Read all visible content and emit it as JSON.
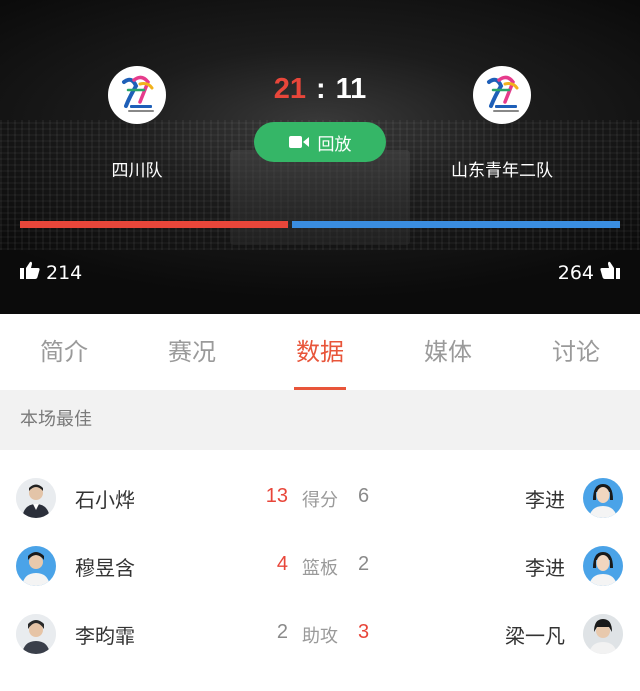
{
  "match": {
    "home": {
      "name": "四川队",
      "score": "21",
      "likes": "214",
      "logo": "tianjin-games-logo"
    },
    "away": {
      "name": "山东青年二队",
      "score": "11",
      "likes": "264",
      "logo": "tianjin-games-logo"
    },
    "separator": ":",
    "replay_label": "回放",
    "colors": {
      "home": "#e8463a",
      "away": "#3a8de0",
      "replay": "#35b667",
      "accent": "#e8553a"
    }
  },
  "progress": {
    "home_fraction": 0.45,
    "away_fraction": 0.55
  },
  "tabs": [
    {
      "label": "简介"
    },
    {
      "label": "赛况"
    },
    {
      "label": "数据",
      "active": true
    },
    {
      "label": "媒体"
    },
    {
      "label": "讨论"
    }
  ],
  "best": {
    "title": "本场最佳",
    "rows": [
      {
        "stat": "得分",
        "home_player": "石小烨",
        "home_value": "13",
        "away_player": "李进",
        "away_value": "6",
        "leader": "home"
      },
      {
        "stat": "篮板",
        "home_player": "穆昱含",
        "home_value": "4",
        "away_player": "李进",
        "away_value": "2",
        "leader": "home"
      },
      {
        "stat": "助攻",
        "home_player": "李昀霏",
        "home_value": "2",
        "away_player": "梁一凡",
        "away_value": "3",
        "leader": "away"
      }
    ]
  }
}
